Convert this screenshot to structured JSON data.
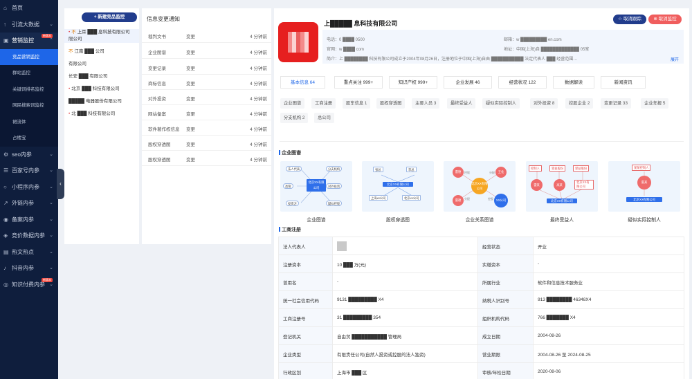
{
  "sidebar": {
    "items": [
      {
        "icon": "home-icon",
        "glyph": "⌂",
        "label": "首页",
        "caret": ""
      },
      {
        "icon": "traffic-icon",
        "glyph": "↑",
        "label": "引流大数据",
        "caret": "⌄"
      },
      {
        "icon": "marketing-icon",
        "glyph": "▣",
        "label": "营销监控",
        "caret": "⌃",
        "badge": "新版本"
      },
      {
        "icon": "seo-icon",
        "glyph": "⚙",
        "label": "seo内参",
        "caret": "⌄"
      },
      {
        "icon": "baijiahao-icon",
        "glyph": "☰",
        "label": "百家号内参",
        "caret": "⌄"
      },
      {
        "icon": "miniapp-icon",
        "glyph": "○",
        "label": "小程序内参",
        "caret": "⌄"
      },
      {
        "icon": "external-icon",
        "glyph": "↗",
        "label": "外链内参",
        "caret": "⌄"
      },
      {
        "icon": "filing-icon",
        "glyph": "◉",
        "label": "备案内参",
        "caret": "⌄"
      },
      {
        "icon": "bidding-icon",
        "glyph": "◈",
        "label": "竞价数据内参",
        "caret": "⌄"
      },
      {
        "icon": "hotspot-icon",
        "glyph": "▤",
        "label": "热文热点",
        "caret": "⌄"
      },
      {
        "icon": "douyin-icon",
        "glyph": "♪",
        "label": "抖音内参",
        "caret": "⌄"
      },
      {
        "icon": "paid-icon",
        "glyph": "◎",
        "label": "知识付费内参",
        "caret": "⌄",
        "badge": "新版本"
      }
    ],
    "sub_items": [
      "竞品营销监控",
      "群站监控",
      "关键词排名监控",
      "网民搜索词监控",
      "裙流体",
      "占楼宝"
    ]
  },
  "monitors": {
    "new_button": "+ 新建竞品监控",
    "items": [
      {
        "prefix": "不",
        "text": "上耳 ███ 息科技有限公司"
      },
      {
        "prefix": "",
        "text": "限公司"
      },
      {
        "prefix": "不",
        "text": "江南 ███ 公司"
      },
      {
        "prefix": "",
        "text": "有限公司"
      },
      {
        "prefix": "",
        "text": "长安 ███ 有限公司"
      },
      {
        "prefix": "",
        "text": "北京 ███ 科技有限公司"
      },
      {
        "prefix": "",
        "text": "█████ 电器股份有限公司"
      },
      {
        "prefix": "",
        "text": "北 ███ 科技有限公司"
      }
    ]
  },
  "changes": {
    "title": "信息变更通知",
    "rows": [
      {
        "type": "裁判文书",
        "action": "变更",
        "time": "4 分钟前"
      },
      {
        "type": "企业图谱",
        "action": "变更",
        "time": "4 分钟前"
      },
      {
        "type": "变更记录",
        "action": "变更",
        "time": "4 分钟前"
      },
      {
        "type": "商标信息",
        "action": "变更",
        "time": "4 分钟前"
      },
      {
        "type": "对外投资",
        "action": "变更",
        "time": "4 分钟前"
      },
      {
        "type": "网站备案",
        "action": "变更",
        "time": "4 分钟前"
      },
      {
        "type": "软件著作权信息",
        "action": "变更",
        "time": "4 分钟前"
      },
      {
        "type": "股权穿透图",
        "action": "变更",
        "time": "4 分钟前"
      },
      {
        "type": "股权穿透图",
        "action": "变更",
        "time": "4 分钟前"
      }
    ]
  },
  "company": {
    "name": "上█████ 息科技有限公司",
    "unfollow_label": "取消跟踪",
    "unmonitor_label": "取消监控",
    "info": {
      "phone": "电话：0 ████ 0500",
      "email": "邮箱：w █████████ en.com",
      "website": "官网：w ████ com",
      "address": "地址：中国(上海)自 █████████████ 05室",
      "intro": "简介：上 ████████ 科技有限公司成立于2004年08月26日，注册地位于中国(上海)自由 ███████████ 法定代表人 ███ 经营范围…",
      "expand": "展开"
    },
    "tabs": [
      {
        "label": "基本信息 64",
        "active": true
      },
      {
        "label": "重点关注 999+",
        "active": false
      },
      {
        "label": "知识产权 999+",
        "active": false
      },
      {
        "label": "企业发展 46",
        "active": false
      },
      {
        "label": "经营状况 122",
        "active": false
      },
      {
        "label": "数据解读",
        "active": false
      },
      {
        "label": "新闻资讯",
        "active": false
      }
    ],
    "subtabs": [
      "企业图谱",
      "工商注册",
      "股东信息 1",
      "股权穿透图",
      "主要人员 3",
      "最终受益人",
      "疑似实际控制人",
      "对外投资 8",
      "控股企业 2",
      "变更记录 33",
      "企业年报 5",
      "分支机构 2",
      "总公司"
    ]
  },
  "graphs": {
    "section_title": "企业图谱",
    "captions": [
      "企业图谱",
      "股权穿透图",
      "企业关系图谱",
      "最终受益人",
      "疑似实际控制人"
    ],
    "g1": {
      "nodes": [
        "法人代表",
        "分支机构",
        "高管",
        "对外投资",
        "投资方",
        "疑似控股"
      ],
      "center": "北京XX有限公司"
    },
    "g2": {
      "top": [
        "张总",
        "李总"
      ],
      "center": "北京XX有限公司",
      "bottom": [
        "上海xx公司",
        "北京xx公司"
      ]
    },
    "g3": {
      "center": "北京XX有限公司",
      "nodes": [
        "雷德",
        "王化",
        "雷德",
        "XX公司"
      ],
      "links": [
        "控股",
        "分配",
        "分配",
        "控股"
      ]
    },
    "g4": {
      "top": [
        "控制人",
        "受益股份",
        "受益股份"
      ],
      "mid": [
        "雷某",
        "高某",
        "北京XX有限公司"
      ],
      "bottom": "北京XX有限公司"
    },
    "g5": {
      "top": "某某控制人",
      "mid": "雷某",
      "bottom": "北京XX有限公司"
    }
  },
  "registration": {
    "section_title": "工商注册",
    "rows": [
      {
        "l1": "法人代表人",
        "v1": "",
        "l2": "经营状态",
        "v2": "开业"
      },
      {
        "l1": "注册资本",
        "v1": "10 ███ 万(元)",
        "l2": "实缴资本",
        "v2": "-"
      },
      {
        "l1": "曾用名",
        "v1": "-",
        "l2": "所属行业",
        "v2": "软件和信息技术服务业"
      },
      {
        "l1": "统一社会信用代码",
        "v1": "9131 █████████ X4",
        "l2": "纳税人识别号",
        "v2": "913 ████████ 46348X4"
      },
      {
        "l1": "工商注册号",
        "v1": "31 █████████ 354",
        "l2": "组织机构代码",
        "v2": "766 ███████ X4"
      },
      {
        "l1": "登记机关",
        "v1": "自由贸 ███████████ 管理局",
        "l2": "成立日期",
        "v2": "2004-08-26"
      },
      {
        "l1": "企业类型",
        "v1": "有限责任公司(自然人投资或控股的法人独资)",
        "l2": "营业期限",
        "v2": "2004-08-26 至 2024-08-25"
      },
      {
        "l1": "行政区划",
        "v1": "上海市 ███ 区",
        "l2": "审核/年检日期",
        "v2": "2020-08-06"
      }
    ]
  },
  "colors": {
    "sidebar": "#0f1e3d",
    "accent": "#1e66e8",
    "danger": "#f05d5d",
    "navy_button": "#213c8c"
  }
}
